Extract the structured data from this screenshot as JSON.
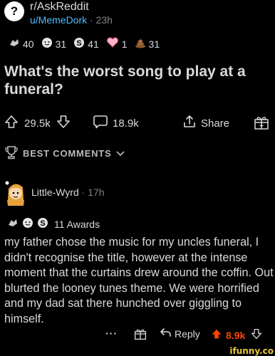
{
  "post": {
    "subreddit": "r/AskReddit",
    "username": "u/MemeDork",
    "separator": "·",
    "age": "23h",
    "awards": [
      {
        "icon": "silver-award-icon",
        "count": "40"
      },
      {
        "icon": "wholesome-award-icon",
        "count": "31"
      },
      {
        "icon": "s-award-icon",
        "count": "41"
      },
      {
        "icon": "heart-award-icon",
        "count": "1"
      },
      {
        "icon": "poop-award-icon",
        "count": "31"
      }
    ],
    "title": "What's the worst song to play at a funeral?",
    "upvotes": "29.5k",
    "comments": "18.9k",
    "share_label": "Share"
  },
  "sort": {
    "label": "BEST COMMENTS",
    "icon": "trophy-icon"
  },
  "comment": {
    "author": "Little-Wyrd",
    "separator": "·",
    "age": "17h",
    "awards_label": "11 Awards",
    "body": "my father chose the music for my uncles funeral, I didn't recognise the title, however at the intense moment that the curtains drew around the coffin. Out blurted the looney tunes theme. We were horrified and my dad sat there hunched over giggling to himself.",
    "more_label": "···",
    "reply_label": "Reply",
    "score": "8.9k",
    "upvote_color": "#ff4500"
  },
  "watermark": "ifunny.co"
}
